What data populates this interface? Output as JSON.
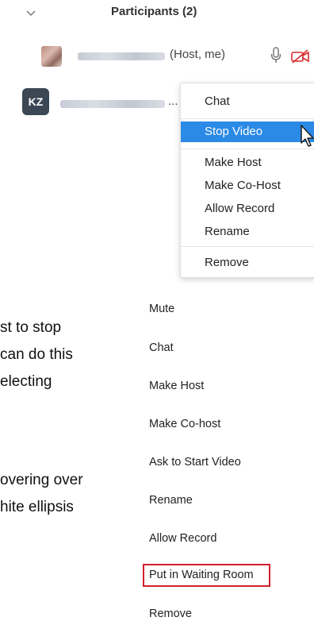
{
  "header": {
    "title": "Participants (2)",
    "collapse_icon": "chevron-down-icon"
  },
  "participants": [
    {
      "initials": "",
      "tag": "(Host, me)",
      "icons": [
        "microphone-icon",
        "video-off-icon"
      ]
    },
    {
      "initials": "KZ",
      "truncation": "..."
    }
  ],
  "context_menu": {
    "items": [
      "Chat",
      "Stop Video",
      "Make Host",
      "Make Co-Host",
      "Allow Record",
      "Rename",
      "Remove"
    ],
    "active": "Stop Video",
    "active_color": "#2b8ae6"
  },
  "body_text": {
    "lines_top": [
      "st to stop",
      "can do this",
      "electing"
    ],
    "lines_bottom": [
      "overing over",
      "hite ellipsis"
    ]
  },
  "mobile_menu": {
    "items": [
      "Mute",
      "Chat",
      "Make Host",
      "Make Co-host",
      "Ask to Start Video",
      "Rename",
      "Allow Record",
      "Put in Waiting Room",
      "Remove"
    ],
    "highlighted": "Put in Waiting Room",
    "highlight_color": "#d21f2b"
  }
}
